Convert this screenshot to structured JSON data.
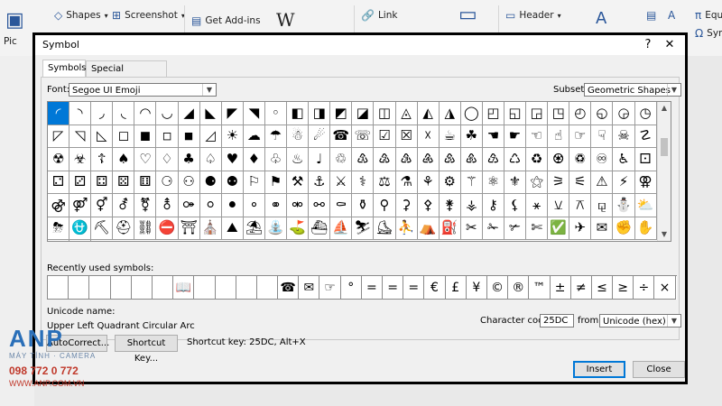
{
  "ribbon": {
    "pic_label": "Pic",
    "shapes": "Shapes",
    "screenshot": "Screenshot",
    "get_addins": "Get Add-ins",
    "wiki_icon": "W",
    "link": "Link",
    "header": "Header",
    "equation_short": "Equ",
    "symbol_short": "Sym"
  },
  "dialog": {
    "title": "Symbol",
    "help_icon": "?",
    "close_icon": "✕",
    "tabs": [
      {
        "label": "Symbols",
        "active": true
      },
      {
        "label": "Special Characters",
        "active": false
      }
    ],
    "font_label": "Font:",
    "font_value": "Segoe UI Emoji",
    "subset_label": "Subset:",
    "subset_value": "Geometric Shapes",
    "symbols": [
      "◜",
      "◝",
      "◞",
      "◟",
      "◠",
      "◡",
      "◢",
      "◣",
      "◤",
      "◥",
      "◦",
      "◧",
      "◨",
      "◩",
      "◪",
      "◫",
      "◬",
      "◭",
      "◮",
      "◯",
      "◰",
      "◱",
      "◲",
      "◳",
      "◴",
      "◵",
      "◶",
      "◷",
      "◸",
      "◹",
      "◺",
      "◻",
      "◼",
      "◽",
      "◾",
      "◿",
      "☀",
      "☁",
      "☂",
      "☃",
      "☄",
      "☎",
      "☏",
      "☑",
      "☒",
      "☓",
      "☕",
      "☘",
      "☚",
      "☛",
      "☜",
      "☝",
      "☞",
      "☟",
      "☠",
      "☡",
      "☢",
      "☣",
      "☦",
      "♠",
      "♡",
      "♢",
      "♣",
      "♤",
      "♥",
      "♦",
      "♧",
      "♨",
      "♩",
      "♲",
      "♳",
      "♴",
      "♵",
      "♶",
      "♷",
      "♸",
      "♹",
      "♺",
      "♻",
      "♼",
      "♽",
      "♾",
      "♿",
      "⚀",
      "⚁",
      "⚂",
      "⚃",
      "⚄",
      "⚅",
      "⚆",
      "⚇",
      "⚈",
      "⚉",
      "⚐",
      "⚑",
      "⚒",
      "⚓",
      "⚔",
      "⚕",
      "⚖",
      "⚗",
      "⚘",
      "⚙",
      "⚚",
      "⚛",
      "⚜",
      "⚝",
      "⚞",
      "⚟",
      "⚠",
      "⚡",
      "⚢",
      "⚣",
      "⚤",
      "⚥",
      "⚦",
      "⚧",
      "⚨",
      "⚩",
      "⚪",
      "⚫",
      "⚬",
      "⚭",
      "⚮",
      "⚯",
      "⚰",
      "⚱",
      "⚲",
      "⚳",
      "⚴",
      "⚵",
      "⚶",
      "⚷",
      "⚸",
      "⚹",
      "⚺",
      "⚻",
      "⚼",
      "⛄",
      "⛅",
      "⛈",
      "⛎",
      "⛏",
      "⛑",
      "⛓",
      "⛔",
      "⛩",
      "⛪",
      "⛰",
      "⛱",
      "⛲",
      "⛳",
      "⛴",
      "⛵",
      "⛷",
      "⛸",
      "⛹",
      "⛺",
      "⛽",
      "✂",
      "✁",
      "✃",
      "✄",
      "✅",
      "✈",
      "✉",
      "✊",
      "✋",
      "✌",
      "✍"
    ],
    "selected_index": 0,
    "recent_label": "Recently used symbols:",
    "recent_symbols": [
      "",
      "",
      "",
      "",
      "",
      "",
      "📖",
      "",
      "",
      "",
      "",
      "☎",
      "✉",
      "☞",
      "°",
      "=",
      "=",
      "=",
      "€",
      "£",
      "¥",
      "©",
      "®",
      "™",
      "±",
      "≠",
      "≤",
      "≥",
      "÷",
      "×"
    ],
    "unicode_name_label": "Unicode name:",
    "unicode_name_value": "Upper Left Quadrant Circular Arc",
    "char_code_label": "Character code:",
    "char_code_value": "25DC",
    "from_label": "from:",
    "from_value": "Unicode (hex)",
    "autocorrect_label": "AutoCorrect...",
    "shortcut_key_button": "Shortcut Key...",
    "shortcut_key_text": "Shortcut key: 25DC, Alt+X",
    "insert_label": "Insert",
    "close_label": "Close"
  },
  "watermark": {
    "brand": "ANP",
    "sub": "MÁY TÍNH · CAMERA",
    "phone": "098 772 0 772",
    "website": "WWW.ANP.COM.VN"
  }
}
